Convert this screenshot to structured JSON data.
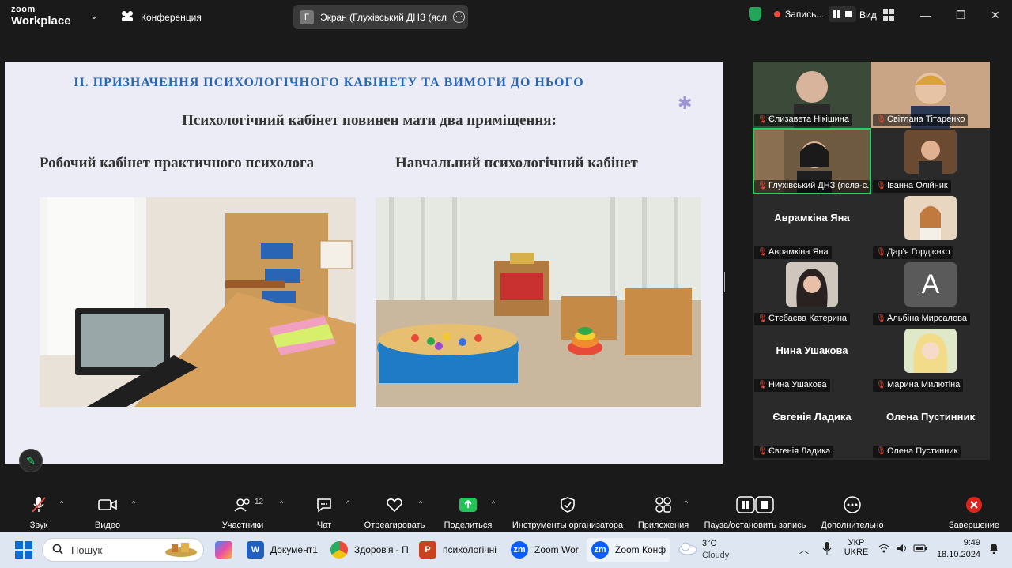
{
  "app": {
    "brand_top": "zoom",
    "brand_bottom": "Workplace",
    "meeting_label": "Конференция"
  },
  "share": {
    "badge": "Г",
    "title": "Экран (Глухівський ДНЗ (ясла-с"
  },
  "recording": {
    "label": "Запись..."
  },
  "view": {
    "label": "Вид"
  },
  "slide": {
    "title": "ІІ. ПРИЗНАЧЕННЯ ПСИХОЛОГІЧНОГО КАБІНЕТУ ТА ВИМОГИ ДО НЬОГО",
    "subtitle": "Психологічний кабінет повинен мати два приміщення:",
    "left_caption": "Робочий  кабінет практичного психолога",
    "right_caption": "Навчальний  психологічний кабінет"
  },
  "participants": [
    {
      "name": "Єлизавета Нікішина",
      "kind": "video"
    },
    {
      "name": "Світлана Тітаренко",
      "kind": "video"
    },
    {
      "name": "Глухівський ДНЗ (ясла-с...",
      "kind": "video"
    },
    {
      "name": "Іванна Олійник",
      "kind": "photo"
    },
    {
      "name": "Аврамкіна Яна",
      "big": "Аврамкіна Яна",
      "kind": "text"
    },
    {
      "name": "Дар'я Гордієнко",
      "kind": "photo"
    },
    {
      "name": "Стєбаєва Катерина",
      "kind": "photo"
    },
    {
      "name": "Альбіна Мирсалова",
      "avatar": "A",
      "kind": "avatar"
    },
    {
      "name": "Нина Ушакова",
      "big": "Нина Ушакова",
      "kind": "text"
    },
    {
      "name": "Марина Милютіна",
      "kind": "photo"
    },
    {
      "name": "Євгенія Ладика",
      "big": "Євгенія Ладика",
      "kind": "text"
    },
    {
      "name": "Олена Пустинник",
      "big": "Олена Пустинник",
      "kind": "text"
    }
  ],
  "toolbar": {
    "audio": "Звук",
    "video": "Видео",
    "participants": "Участники",
    "participants_count": "12",
    "chat": "Чат",
    "react": "Отреагировать",
    "share": "Поделиться",
    "host_tools": "Инструменты организатора",
    "apps": "Приложения",
    "pause_rec": "Пауза/остановить запись",
    "more": "Дополнительно",
    "end": "Завершение"
  },
  "taskbar": {
    "search": "Пошук",
    "items": [
      "Документ1",
      "Здоров'я - П",
      "психологічні",
      "Zoom Wor",
      "Zoom Конф"
    ],
    "weather_temp": "3°C",
    "weather_desc": "Cloudy",
    "lang_top": "УКР",
    "lang_bottom": "UKRE",
    "time": "9:49",
    "date": "18.10.2024"
  }
}
